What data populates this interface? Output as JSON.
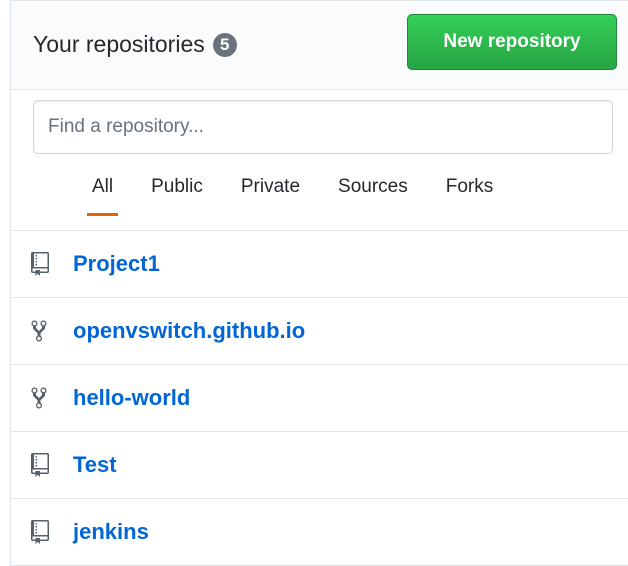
{
  "header": {
    "title": "Your repositories",
    "count": "5",
    "new_button_label": "New repository"
  },
  "search": {
    "placeholder": "Find a repository...",
    "value": ""
  },
  "filter_tabs": [
    {
      "label": "All",
      "selected": true
    },
    {
      "label": "Public",
      "selected": false
    },
    {
      "label": "Private",
      "selected": false
    },
    {
      "label": "Sources",
      "selected": false
    },
    {
      "label": "Forks",
      "selected": false
    }
  ],
  "repositories": [
    {
      "name": "Project1",
      "icon": "repo-icon"
    },
    {
      "name": "openvswitch.github.io",
      "icon": "repo-forked-icon"
    },
    {
      "name": "hello-world",
      "icon": "repo-forked-icon"
    },
    {
      "name": "Test",
      "icon": "repo-icon"
    },
    {
      "name": "jenkins",
      "icon": "repo-icon"
    }
  ],
  "colors": {
    "link": "#0366d6",
    "button_green": "#28a745",
    "selected_tab_underline": "#e36209",
    "badge": "#6a737d"
  }
}
